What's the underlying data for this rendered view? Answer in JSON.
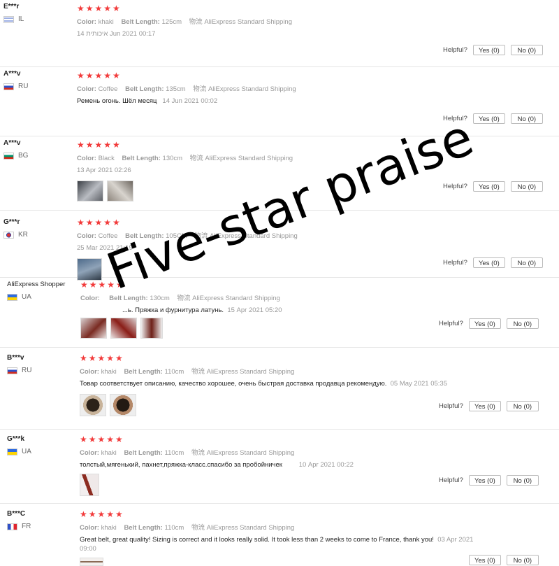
{
  "labels": {
    "helpful": "Helpful?",
    "yes": "Yes (0)",
    "no": "No (0)",
    "color": "Color:",
    "belt_length": "Belt Length:",
    "shipping_label": "物流",
    "stars": "★★★★★"
  },
  "watermark": "Five-star praise",
  "reviews": [
    {
      "user": "E***r",
      "country": "IL",
      "color": "khaki",
      "belt_length": "125cm",
      "shipping": "AliExpress Standard Shipping",
      "text": "",
      "date": "14 איכותית Jun 2021 00:17"
    },
    {
      "user": "A***v",
      "country": "RU",
      "color": "Coffee",
      "belt_length": "135cm",
      "shipping": "AliExpress Standard Shipping",
      "text": "Ремень огонь. Шёл месяц",
      "date": "14 Jun 2021 00:02"
    },
    {
      "user": "A***v",
      "country": "BG",
      "color": "Black",
      "belt_length": "130cm",
      "shipping": "AliExpress Standard Shipping",
      "text": "",
      "date": "13 Apr 2021 02:26"
    },
    {
      "user": "G***r",
      "country": "KR",
      "color": "Coffee",
      "belt_length": "105CM",
      "shipping": "AliExpress Standard Shipping",
      "text": "",
      "date": "25 Mar 2021 21:19"
    },
    {
      "user": "AliExpress Shopper",
      "country": "UA",
      "color": "",
      "belt_length": "130cm",
      "shipping": "AliExpress Standard Shipping",
      "text": "...ь. Пряжка и фурнитура латунь.",
      "date": "15 Apr 2021 05:20"
    },
    {
      "user": "B***v",
      "country": "RU",
      "color": "khaki",
      "belt_length": "110cm",
      "shipping": "AliExpress Standard Shipping",
      "text": "Товар соответствует описанию, качество хорошее, очень быстрая доставка продавца рекомендую.",
      "date": "05 May 2021 05:35"
    },
    {
      "user": "G***k",
      "country": "UA",
      "color": "khaki",
      "belt_length": "110cm",
      "shipping": "AliExpress Standard Shipping",
      "text": "толстый,мягенький, пахнет,пряжка-класс.спасибо за пробойничек",
      "date": "10 Apr 2021 00:22"
    },
    {
      "user": "B***C",
      "country": "FR",
      "color": "khaki",
      "belt_length": "110cm",
      "shipping": "AliExpress Standard Shipping",
      "text": "Great belt, great quality! Sizing is correct and it looks really solid. It took less than 2 weeks to come to France, thank you!",
      "date": "03 Apr 2021 09:00"
    }
  ]
}
